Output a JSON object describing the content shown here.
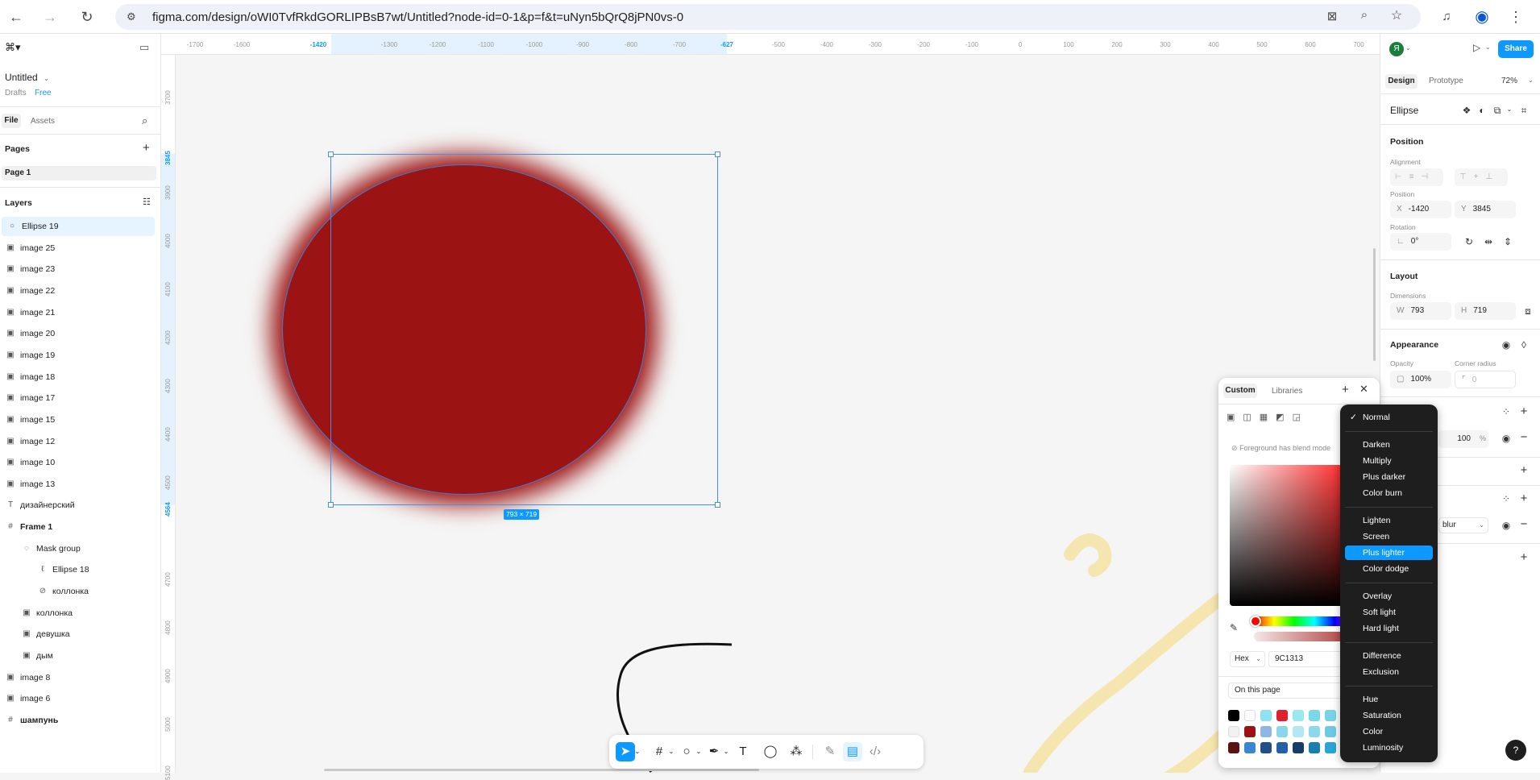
{
  "browser": {
    "url": "figma.com/design/oWI0TvfRkdGORLIPBsB7wt/Untitled?node-id=0-1&p=f&t=uNyn5bQrQ8jPN0vs-0",
    "back_icon": "arrow-left-icon",
    "forward_icon": "arrow-right-icon",
    "reload_icon": "reload-icon"
  },
  "file": {
    "title": "Untitled",
    "location": "Drafts",
    "plan": "Free"
  },
  "left_tabs": {
    "file": "File",
    "assets": "Assets"
  },
  "pages": {
    "header": "Pages",
    "items": [
      "Page 1"
    ]
  },
  "layers": {
    "header": "Layers",
    "items": [
      {
        "icon": "○",
        "name": "Ellipse 19"
      },
      {
        "icon": "▣",
        "name": "image 25"
      },
      {
        "icon": "▣",
        "name": "image 23"
      },
      {
        "icon": "▣",
        "name": "image 22"
      },
      {
        "icon": "▣",
        "name": "image 21"
      },
      {
        "icon": "▣",
        "name": "image 20"
      },
      {
        "icon": "▣",
        "name": "image 19"
      },
      {
        "icon": "▣",
        "name": "image 18"
      },
      {
        "icon": "▣",
        "name": "image 17"
      },
      {
        "icon": "▣",
        "name": "image 15"
      },
      {
        "icon": "▣",
        "name": "image 12"
      },
      {
        "icon": "▣",
        "name": "image 10"
      },
      {
        "icon": "▣",
        "name": "image 13"
      },
      {
        "icon": "T",
        "name": "дизайнерский"
      },
      {
        "icon": "#",
        "name": "Frame 1"
      },
      {
        "icon": "◌",
        "name": "Mask group"
      },
      {
        "icon": "ℓ",
        "name": "Ellipse 18"
      },
      {
        "icon": "⊘",
        "name": "коллонка"
      },
      {
        "icon": "▣",
        "name": "коллонка"
      },
      {
        "icon": "▣",
        "name": "девушка"
      },
      {
        "icon": "▣",
        "name": "дым"
      },
      {
        "icon": "▣",
        "name": "image 8"
      },
      {
        "icon": "▣",
        "name": "image 6"
      },
      {
        "icon": "#",
        "name": "шампунь"
      }
    ]
  },
  "ruler": {
    "top": [
      "-1700",
      "-1600",
      "-1420",
      "-1300",
      "-1200",
      "-1100",
      "-1000",
      "-900",
      "-800",
      "-700",
      "-627",
      "-500",
      "-400",
      "-300",
      "-200",
      "-100",
      "0",
      "100",
      "200",
      "300",
      "400",
      "500",
      "600",
      "700"
    ],
    "left": [
      "3700",
      "3845",
      "3900",
      "4000",
      "4100",
      "4200",
      "4300",
      "4400",
      "4500",
      "4564",
      "4700",
      "4800",
      "4900",
      "5000",
      "5100"
    ]
  },
  "selection": {
    "size_label": "793 × 719"
  },
  "right": {
    "avatar": "Я",
    "share": "Share",
    "tab_design": "Design",
    "tab_prototype": "Prototype",
    "zoom": "72%",
    "layer_name": "Ellipse",
    "position_header": "Position",
    "alignment_label": "Alignment",
    "position_label": "Position",
    "x": "-1420",
    "y": "3845",
    "rotation_label": "Rotation",
    "rotation": "0°",
    "layout_header": "Layout",
    "dimensions_label": "Dimensions",
    "w": "793",
    "h": "719",
    "appearance_header": "Appearance",
    "opacity_label": "Opacity",
    "opacity": "100%",
    "corner_label": "Corner radius",
    "corner": "0",
    "fill_opacity": "100",
    "fill_pct": "%",
    "effect": "blur"
  },
  "picker": {
    "tab_custom": "Custom",
    "tab_libraries": "Libraries",
    "warning": "Foreground has blend mode",
    "format": "Hex",
    "hex": "9C1313",
    "swatch_header": "On this page",
    "colors": {
      "fill": "#9c1313",
      "accent": "#0d99ff"
    }
  },
  "blend": {
    "groups": [
      [
        "Normal"
      ],
      [
        "Darken",
        "Multiply",
        "Plus darker",
        "Color burn"
      ],
      [
        "Lighten",
        "Screen",
        "Plus lighter",
        "Color dodge"
      ],
      [
        "Overlay",
        "Soft light",
        "Hard light"
      ],
      [
        "Difference",
        "Exclusion"
      ],
      [
        "Hue",
        "Saturation",
        "Color",
        "Luminosity"
      ]
    ],
    "checked": "Normal",
    "highlighted": "Plus lighter"
  }
}
